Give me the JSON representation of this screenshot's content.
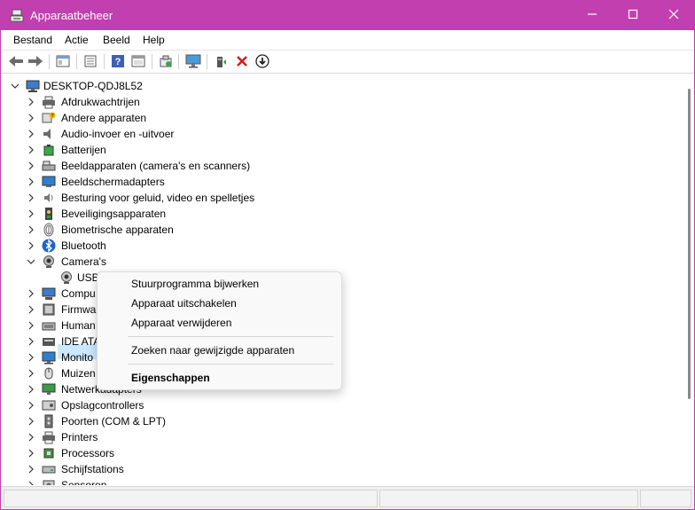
{
  "window": {
    "title": "Apparaatbeheer",
    "accent": "#c13fae"
  },
  "menubar": [
    "Bestand",
    "Actie",
    "Beeld",
    "Help"
  ],
  "toolbar": [
    "back-icon",
    "forward-icon",
    "properties-view-icon",
    "details-icon",
    "help-icon",
    "console-icon",
    "scan-hardware-icon",
    "monitor-icon",
    "update-driver-icon",
    "uninstall-icon",
    "disable-icon"
  ],
  "tree": {
    "root": "DESKTOP-QDJ8L52",
    "items": [
      {
        "label": "Afdrukwachtrijen",
        "icon": "printer-queue-icon"
      },
      {
        "label": "Andere apparaten",
        "icon": "unknown-device-icon"
      },
      {
        "label": "Audio-invoer en -uitvoer",
        "icon": "speaker-icon"
      },
      {
        "label": "Batterijen",
        "icon": "battery-icon"
      },
      {
        "label": "Beeldapparaten (camera's en scanners)",
        "icon": "scanner-icon"
      },
      {
        "label": "Beeldschermadapters",
        "icon": "display-adapter-icon"
      },
      {
        "label": "Besturing voor geluid, video en spelletjes",
        "icon": "sound-icon"
      },
      {
        "label": "Beveiligingsapparaten",
        "icon": "security-icon"
      },
      {
        "label": "Biometrische apparaten",
        "icon": "fingerprint-icon"
      },
      {
        "label": "Bluetooth",
        "icon": "bluetooth-icon"
      },
      {
        "label": "Camera's",
        "icon": "camera-icon",
        "expanded": true
      },
      {
        "label": "USB",
        "icon": "webcam-icon",
        "child": true,
        "selected": true
      },
      {
        "label": "Compu",
        "icon": "computer-icon"
      },
      {
        "label": "Firmwa",
        "icon": "firmware-icon"
      },
      {
        "label": "Human",
        "icon": "hid-icon"
      },
      {
        "label": "IDE ATA",
        "icon": "ide-icon"
      },
      {
        "label": "Monito",
        "icon": "monitor-icon"
      },
      {
        "label": "Muizen",
        "icon": "mouse-icon"
      },
      {
        "label": "Netwerkadapters",
        "icon": "network-icon"
      },
      {
        "label": "Opslagcontrollers",
        "icon": "storage-icon"
      },
      {
        "label": "Poorten (COM & LPT)",
        "icon": "port-icon"
      },
      {
        "label": "Printers",
        "icon": "printer-icon"
      },
      {
        "label": "Processors",
        "icon": "cpu-icon"
      },
      {
        "label": "Schijfstations",
        "icon": "disk-icon"
      },
      {
        "label": "Sensoren",
        "icon": "sensor-icon"
      }
    ]
  },
  "context_menu": {
    "items": [
      {
        "label": "Stuurprogramma bijwerken"
      },
      {
        "label": "Apparaat uitschakelen"
      },
      {
        "label": "Apparaat verwijderen"
      },
      {
        "label": "Zoeken naar gewijzigde apparaten"
      },
      {
        "label": "Eigenschappen"
      }
    ]
  }
}
